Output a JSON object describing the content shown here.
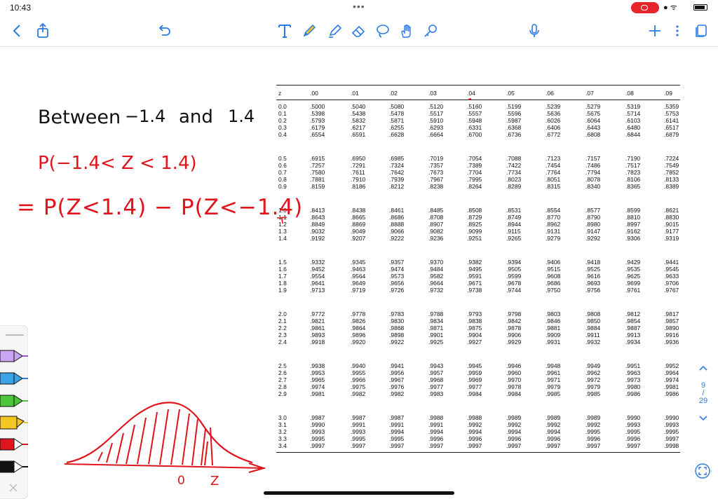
{
  "status": {
    "time": "10:43",
    "dots": "•••"
  },
  "toolbar": {
    "left": [
      "back-icon",
      "share-icon",
      "undo-icon"
    ],
    "tools": [
      "text-tool-icon",
      "pen-icon",
      "highlighter-icon",
      "eraser-icon",
      "lasso-icon",
      "hand-icon",
      "ruler-icon"
    ],
    "right": [
      "microphone-icon",
      "add-page-icon",
      "more-icon",
      "pages-icon"
    ]
  },
  "notes": {
    "line1a": "Between",
    "line1b": "−1.4",
    "line1c": "and",
    "line1d": "1.4",
    "line2": "P(−1.4< Z < 1.4)",
    "line3": "= P(Z<1.4) − P(Z<−1.4)",
    "curve_label_0": "0",
    "curve_label_z": "Z"
  },
  "ztable": {
    "headers": [
      "z",
      ".00",
      ".01",
      ".02",
      ".03",
      ".04",
      ".05",
      ".06",
      ".07",
      ".08",
      ".09"
    ],
    "groups": [
      [
        [
          "0.0",
          ".5000",
          ".5040",
          ".5080",
          ".5120",
          ".5160",
          ".5199",
          ".5239",
          ".5279",
          ".5319",
          ".5359"
        ],
        [
          "0.1",
          ".5398",
          ".5438",
          ".5478",
          ".5517",
          ".5557",
          ".5596",
          ".5636",
          ".5675",
          ".5714",
          ".5753"
        ],
        [
          "0.2",
          ".5793",
          ".5832",
          ".5871",
          ".5910",
          ".5948",
          ".5987",
          ".6026",
          ".6064",
          ".6103",
          ".6141"
        ],
        [
          "0.3",
          ".6179",
          ".6217",
          ".6255",
          ".6293",
          ".6331",
          ".6368",
          ".6406",
          ".6443",
          ".6480",
          ".6517"
        ],
        [
          "0.4",
          ".6554",
          ".6591",
          ".6628",
          ".6664",
          ".6700",
          ".6736",
          ".6772",
          ".6808",
          ".6844",
          ".6879"
        ]
      ],
      [
        [
          "0.5",
          ".6915",
          ".6950",
          ".6985",
          ".7019",
          ".7054",
          ".7088",
          ".7123",
          ".7157",
          ".7190",
          ".7224"
        ],
        [
          "0.6",
          ".7257",
          ".7291",
          ".7324",
          ".7357",
          ".7389",
          ".7422",
          ".7454",
          ".7486",
          ".7517",
          ".7549"
        ],
        [
          "0.7",
          ".7580",
          ".7611",
          ".7642",
          ".7673",
          ".7704",
          ".7734",
          ".7764",
          ".7794",
          ".7823",
          ".7852"
        ],
        [
          "0.8",
          ".7881",
          ".7910",
          ".7939",
          ".7967",
          ".7995",
          ".8023",
          ".8051",
          ".8078",
          ".8106",
          ".8133"
        ],
        [
          "0.9",
          ".8159",
          ".8186",
          ".8212",
          ".8238",
          ".8264",
          ".8289",
          ".8315",
          ".8340",
          ".8365",
          ".8389"
        ]
      ],
      [
        [
          "1.0",
          ".8413",
          ".8438",
          ".8461",
          ".8485",
          ".8508",
          ".8531",
          ".8554",
          ".8577",
          ".8599",
          ".8621"
        ],
        [
          "1.1",
          ".8643",
          ".8665",
          ".8686",
          ".8708",
          ".8729",
          ".8749",
          ".8770",
          ".8790",
          ".8810",
          ".8830"
        ],
        [
          "1.2",
          ".8849",
          ".8869",
          ".8888",
          ".8907",
          ".8925",
          ".8944",
          ".8962",
          ".8980",
          ".8997",
          ".9015"
        ],
        [
          "1.3",
          ".9032",
          ".9049",
          ".9066",
          ".9082",
          ".9099",
          ".9115",
          ".9131",
          ".9147",
          ".9162",
          ".9177"
        ],
        [
          "1.4",
          ".9192",
          ".9207",
          ".9222",
          ".9236",
          ".9251",
          ".9265",
          ".9279",
          ".9292",
          ".9306",
          ".9319"
        ]
      ],
      [
        [
          "1.5",
          ".9332",
          ".9345",
          ".9357",
          ".9370",
          ".9382",
          ".9394",
          ".9406",
          ".9418",
          ".9429",
          ".9441"
        ],
        [
          "1.6",
          ".9452",
          ".9463",
          ".9474",
          ".9484",
          ".9495",
          ".9505",
          ".9515",
          ".9525",
          ".9535",
          ".9545"
        ],
        [
          "1.7",
          ".9554",
          ".9564",
          ".9573",
          ".9582",
          ".9591",
          ".9599",
          ".9608",
          ".9616",
          ".9625",
          ".9633"
        ],
        [
          "1.8",
          ".9641",
          ".9649",
          ".9656",
          ".9664",
          ".9671",
          ".9678",
          ".9686",
          ".9693",
          ".9699",
          ".9706"
        ],
        [
          "1.9",
          ".9713",
          ".9719",
          ".9726",
          ".9732",
          ".9738",
          ".9744",
          ".9750",
          ".9756",
          ".9761",
          ".9767"
        ]
      ],
      [
        [
          "2.0",
          ".9772",
          ".9778",
          ".9783",
          ".9788",
          ".9793",
          ".9798",
          ".9803",
          ".9808",
          ".9812",
          ".9817"
        ],
        [
          "2.1",
          ".9821",
          ".9826",
          ".9830",
          ".9834",
          ".9838",
          ".9842",
          ".9846",
          ".9850",
          ".9854",
          ".9857"
        ],
        [
          "2.2",
          ".9861",
          ".9864",
          ".9868",
          ".9871",
          ".9875",
          ".9878",
          ".9881",
          ".9884",
          ".9887",
          ".9890"
        ],
        [
          "2.3",
          ".9893",
          ".9896",
          ".9898",
          ".9901",
          ".9904",
          ".9906",
          ".9909",
          ".9911",
          ".9913",
          ".9916"
        ],
        [
          "2.4",
          ".9918",
          ".9920",
          ".9922",
          ".9925",
          ".9927",
          ".9929",
          ".9931",
          ".9932",
          ".9934",
          ".9936"
        ]
      ],
      [
        [
          "2.5",
          ".9938",
          ".9940",
          ".9941",
          ".9943",
          ".9945",
          ".9946",
          ".9948",
          ".9949",
          ".9951",
          ".9952"
        ],
        [
          "2.6",
          ".9953",
          ".9955",
          ".9956",
          ".9957",
          ".9959",
          ".9960",
          ".9961",
          ".9962",
          ".9963",
          ".9964"
        ],
        [
          "2.7",
          ".9965",
          ".9966",
          ".9967",
          ".9968",
          ".9969",
          ".9970",
          ".9971",
          ".9972",
          ".9973",
          ".9974"
        ],
        [
          "2.8",
          ".9974",
          ".9975",
          ".9976",
          ".9977",
          ".9977",
          ".9978",
          ".9979",
          ".9979",
          ".9980",
          ".9981"
        ],
        [
          "2.9",
          ".9981",
          ".9982",
          ".9982",
          ".9983",
          ".9984",
          ".9984",
          ".9985",
          ".9985",
          ".9986",
          ".9986"
        ]
      ],
      [
        [
          "3.0",
          ".9987",
          ".9987",
          ".9987",
          ".9988",
          ".9988",
          ".9989",
          ".9989",
          ".9989",
          ".9990",
          ".9990"
        ],
        [
          "3.1",
          ".9990",
          ".9991",
          ".9991",
          ".9991",
          ".9992",
          ".9992",
          ".9992",
          ".9992",
          ".9993",
          ".9993"
        ],
        [
          "3.2",
          ".9993",
          ".9993",
          ".9994",
          ".9994",
          ".9994",
          ".9994",
          ".9994",
          ".9995",
          ".9995",
          ".9995"
        ],
        [
          "3.3",
          ".9995",
          ".9995",
          ".9995",
          ".9996",
          ".9996",
          ".9996",
          ".9996",
          ".9996",
          ".9996",
          ".9997"
        ],
        [
          "3.4",
          ".9997",
          ".9997",
          ".9997",
          ".9997",
          ".9997",
          ".9997",
          ".9997",
          ".9997",
          ".9997",
          ".9998"
        ]
      ]
    ]
  },
  "pager": {
    "current": "9",
    "separator": "/",
    "total": "29"
  },
  "pen_tray": [
    "separator",
    "purple-pen",
    "blue-pen",
    "green-pen",
    "yellow-highlighter",
    "red-pen",
    "black-pen",
    "close"
  ],
  "colors": {
    "ink_black": "#111111",
    "ink_red": "#e0141c",
    "accent_blue": "#2a7be4",
    "record_red": "#e8242b"
  }
}
